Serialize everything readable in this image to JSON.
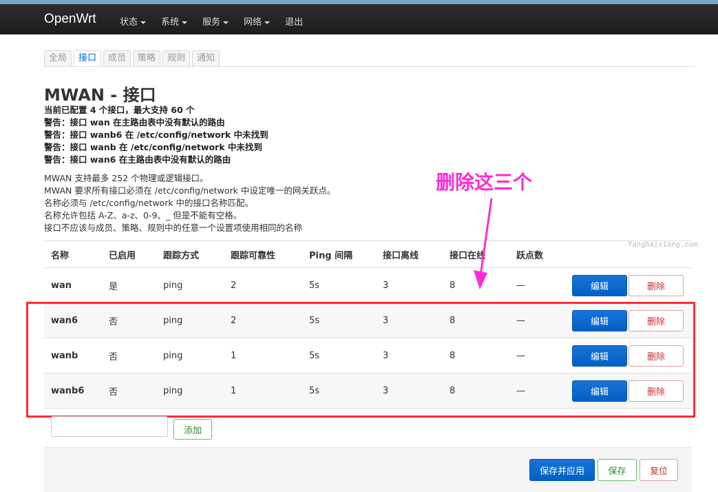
{
  "navbar": {
    "brand": "OpenWrt",
    "menu": [
      "状态",
      "系统",
      "服务",
      "网络",
      "退出"
    ]
  },
  "tabs": [
    "全局",
    "接口",
    "成员",
    "策略",
    "规则",
    "通知"
  ],
  "page": {
    "title": "MWAN - 接口",
    "notices": [
      "当前已配置 4 个接口，最大支持 60 个",
      "警告：接口 wan 在主路由表中没有默认的路由",
      "警告：接口 wanb6 在 /etc/config/network 中未找到",
      "警告：接口 wanb 在 /etc/config/network 中未找到",
      "警告：接口 wan6 在主路由表中没有默认的路由"
    ],
    "description": [
      "MWAN 支持最多 252 个物理或逻辑接口。",
      "MWAN 要求所有接口必须在 /etc/config/network 中设定唯一的网关跃点。",
      "名称必须与 /etc/config/network 中的接口名称匹配。",
      "名称允许包括 A-Z、a-z、0-9、_ 但是不能有空格。",
      "接口不应该与成员、策略、规则中的任意一个设置项使用相同的名称"
    ]
  },
  "annotation": {
    "text": "删除这三个",
    "color": "#ff2bd6",
    "box_color": "#ff2a3a"
  },
  "watermark": "Yanghaixiong.com",
  "table": {
    "headers": [
      "名称",
      "已启用",
      "跟踪方式",
      "跟踪可靠性",
      "Ping 间隔",
      "接口离线",
      "接口在线",
      "跃点数"
    ],
    "rows": [
      [
        "wan",
        "是",
        "ping",
        "2",
        "5s",
        "3",
        "8",
        "—"
      ],
      [
        "wan6",
        "否",
        "ping",
        "2",
        "5s",
        "3",
        "8",
        "—"
      ],
      [
        "wanb",
        "否",
        "ping",
        "1",
        "5s",
        "3",
        "8",
        "—"
      ],
      [
        "wanb6",
        "否",
        "ping",
        "1",
        "5s",
        "3",
        "8",
        "—"
      ]
    ],
    "edit_label": "编辑",
    "delete_label": "删除"
  },
  "add": {
    "button": "添加",
    "value": ""
  },
  "footer": {
    "apply": "保存并应用",
    "save": "保存",
    "reset": "复位"
  }
}
